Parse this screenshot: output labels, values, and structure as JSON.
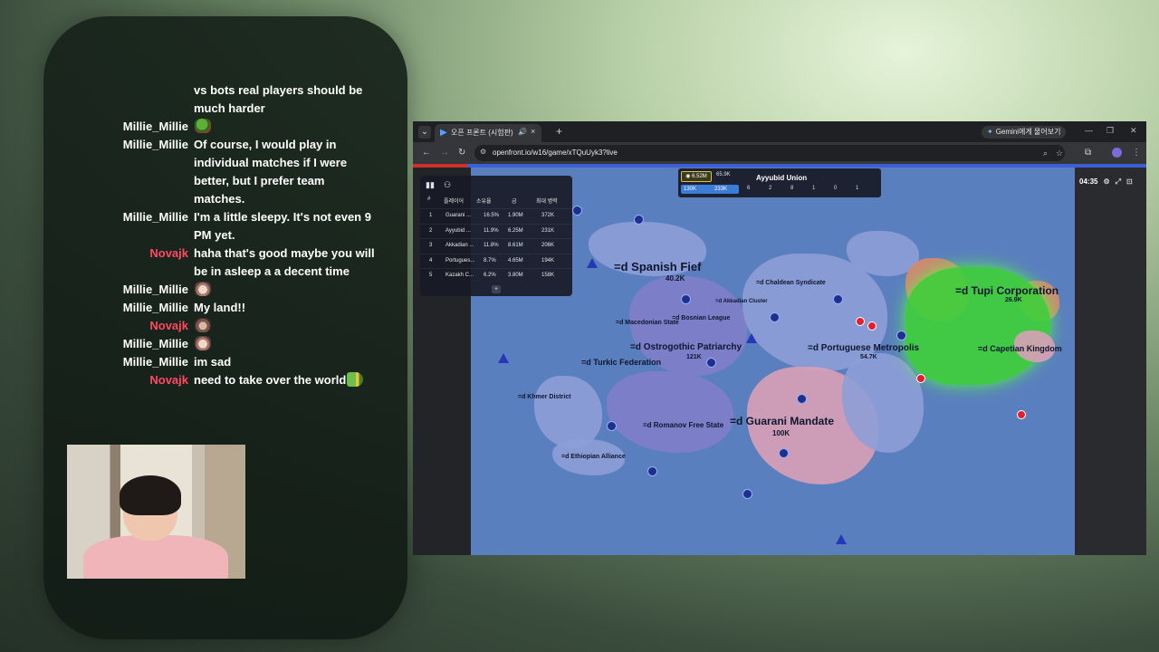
{
  "chat": {
    "messages": [
      {
        "user": "",
        "text": "vs bots real players should be much harder",
        "user_color": "white",
        "emote": ""
      },
      {
        "user": "Millie_Millie",
        "text": "",
        "user_color": "white",
        "emote": "pepe"
      },
      {
        "user": "Millie_Millie",
        "text": "Of course, I would play in individual matches if I were better, but I prefer team matches.",
        "user_color": "white",
        "emote": ""
      },
      {
        "user": "Millie_Millie",
        "text": "I'm a little sleepy. It's not even 9 PM yet.",
        "user_color": "white",
        "emote": ""
      },
      {
        "user": "Novajk",
        "text": "haha that's good maybe you will be in asleep a a decent time",
        "user_color": "red",
        "emote": ""
      },
      {
        "user": "Millie_Millie",
        "text": "",
        "user_color": "white",
        "emote": "cat"
      },
      {
        "user": "Millie_Millie",
        "text": "My land!!",
        "user_color": "white",
        "emote": ""
      },
      {
        "user": "Novajk",
        "text": "",
        "user_color": "red",
        "emote": "cat2"
      },
      {
        "user": "Millie_Millie",
        "text": "",
        "user_color": "white",
        "emote": "cat"
      },
      {
        "user": "Millie_Millie",
        "text": "im sad",
        "user_color": "white",
        "emote": ""
      },
      {
        "user": "Novajk",
        "text": "need to take over the world",
        "user_color": "red",
        "emote": "frog"
      }
    ]
  },
  "browser": {
    "tab_title": "오픈 프론트 (시험판)",
    "gemini_label": "Gemini에게 물어보기",
    "url": "openfront.io/w16/game/xTQuUyk3?live"
  },
  "game": {
    "timer": "04:35",
    "player": {
      "gold": "6.52M",
      "troops": "130K",
      "troops_max": "233K",
      "troop_delta": "65.9K",
      "name": "Ayyubid Union",
      "stats": [
        "6",
        "2",
        "8",
        "1",
        "0",
        "1"
      ]
    },
    "leaderboard": {
      "headers": [
        "#",
        "플레이어",
        "소유율",
        "금",
        "최대 병력"
      ],
      "rows": [
        {
          "rank": "1",
          "name": "Guarani ...",
          "share": "16.5%",
          "gold": "1.90M",
          "troops": "372K"
        },
        {
          "rank": "2",
          "name": "Ayyubid ...",
          "share": "11.9%",
          "gold": "6.25M",
          "troops": "231K"
        },
        {
          "rank": "3",
          "name": "Akkadian ...",
          "share": "11.8%",
          "gold": "8.61M",
          "troops": "206K"
        },
        {
          "rank": "4",
          "name": "Portugues...",
          "share": "8.7%",
          "gold": "4.65M",
          "troops": "194K"
        },
        {
          "rank": "5",
          "name": "Kazakh C...",
          "share": "6.2%",
          "gold": "3.80M",
          "troops": "158K"
        }
      ],
      "more_label": "+"
    },
    "labels": {
      "spanish_fief": "=d Spanish Fief",
      "spanish_fief_troops": "40.2K",
      "tupi": "=d Tupi Corporation",
      "tupi_troops": "26.9K",
      "capetian": "=d Capetian Kingdom",
      "portuguese": "=d Portuguese Metropolis",
      "portuguese_troops": "54.7K",
      "ostrogothic": "=d Ostrogothic Patriarchy",
      "ostrogothic_troops": "121K",
      "turkic": "=d Turkic Federation",
      "guarani": "=d Guarani Mandate",
      "guarani_troops": "100K",
      "romanov": "=d Romanov Free State",
      "khmer": "=d Khmer District",
      "ethiopian": "=d Ethiopian Alliance",
      "chaldean": "=d Chaldean Syndicate",
      "akkadian": "=d Akkadian Cluster",
      "bosnian": "=d Bosnian League",
      "macedonian": "=d Macedonian State"
    }
  }
}
